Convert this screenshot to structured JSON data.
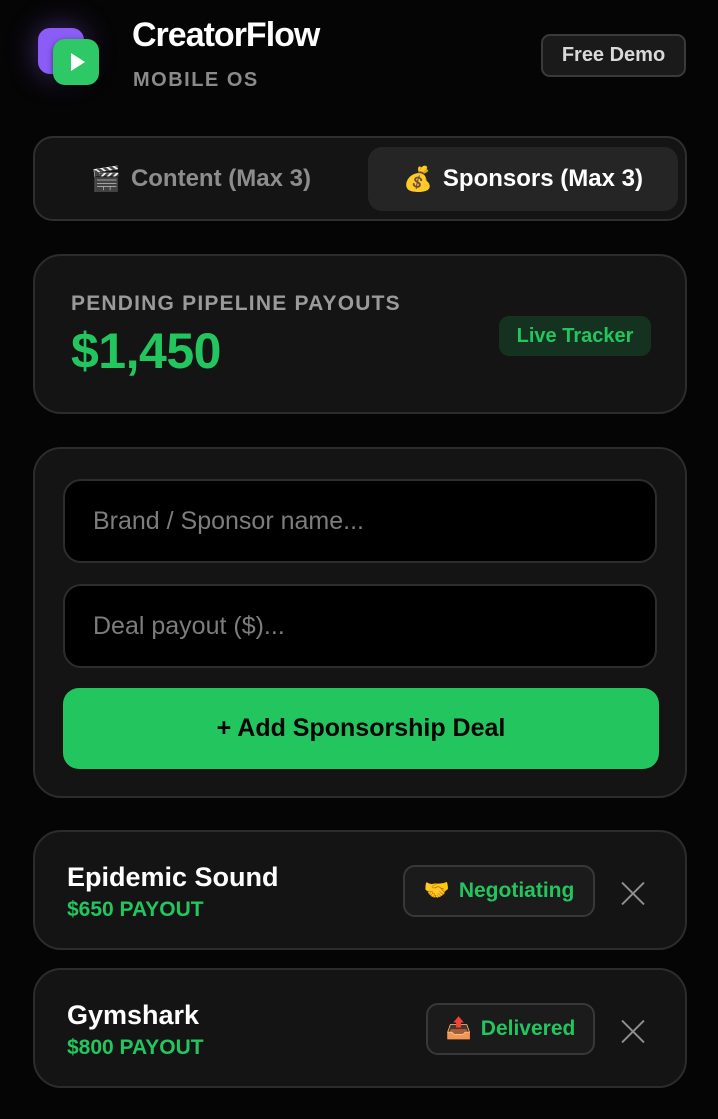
{
  "app": {
    "title": "CreatorFlow",
    "subtitle": "MOBILE OS",
    "demo_label": "Free Demo",
    "logo_icon": "play-logo-icon"
  },
  "tabs": [
    {
      "icon": "🎬",
      "label": "Content (Max 3)",
      "active": false
    },
    {
      "icon": "💰",
      "label": "Sponsors (Max 3)",
      "active": true
    }
  ],
  "summary": {
    "label": "PENDING PIPELINE PAYOUTS",
    "value": "$1,450",
    "badge": "Live Tracker"
  },
  "form": {
    "brand_placeholder": "Brand / Sponsor name...",
    "payout_placeholder": "Deal payout ($)...",
    "submit_label": "+ Add Sponsorship Deal"
  },
  "deals": [
    {
      "name": "Epidemic Sound",
      "payout": "$650 PAYOUT",
      "status_icon": "🤝",
      "status": "Negotiating"
    },
    {
      "name": "Gymshark",
      "payout": "$800 PAYOUT",
      "status_icon": "📤",
      "status": "Delivered"
    }
  ],
  "colors": {
    "background": "#050505",
    "card": "#141414",
    "accent_green": "#22c55e",
    "logo_purple": "#8b5cf6",
    "muted_text": "#8a8a8a"
  },
  "icons": {
    "delete": "close-icon"
  }
}
